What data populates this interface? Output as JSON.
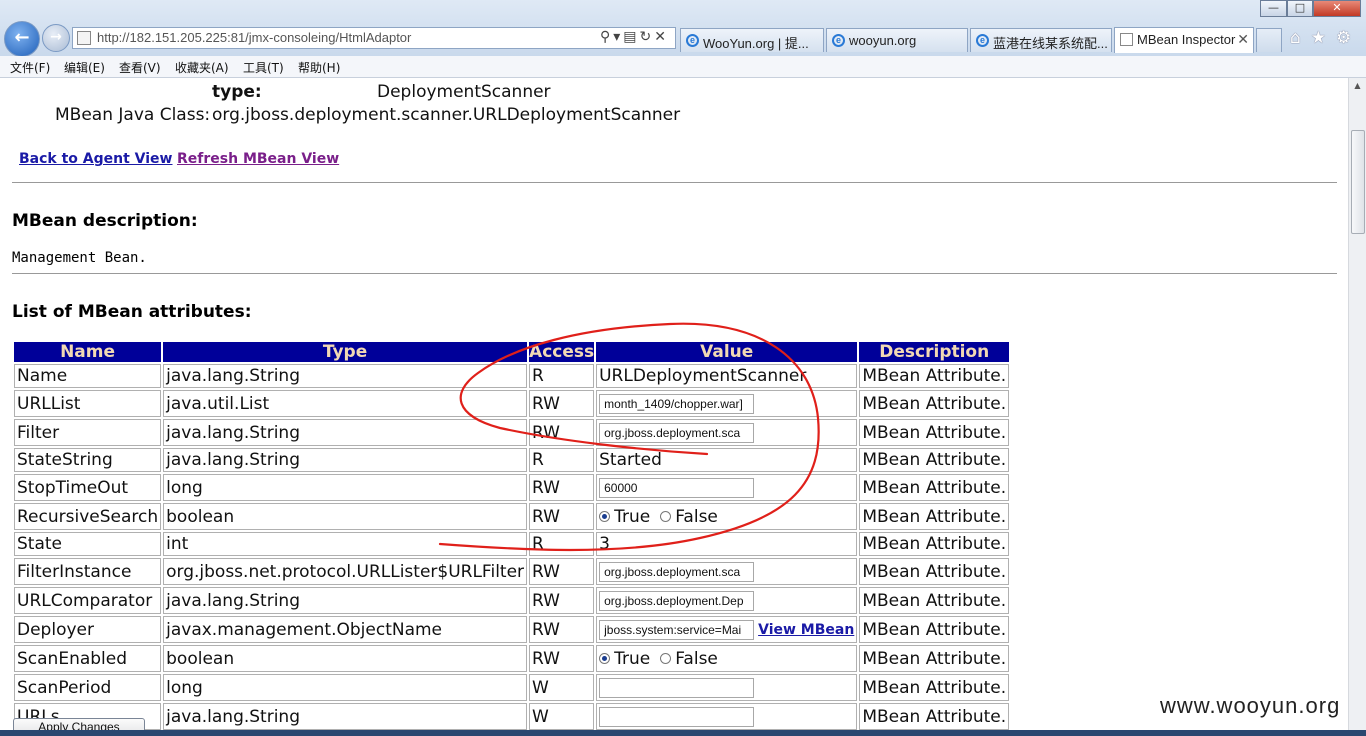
{
  "browser": {
    "url": "http://182.151.205.225:81/jmx-consoleing/HtmlAdaptor",
    "tabs": [
      {
        "label": "WooYun.org | 提...",
        "active": false
      },
      {
        "label": "wooyun.org",
        "active": false
      },
      {
        "label": "蓝港在线某系统配...",
        "active": false
      },
      {
        "label": "MBean Inspector",
        "active": true
      }
    ],
    "menu": [
      "文件(F)",
      "编辑(E)",
      "查看(V)",
      "收藏夹(A)",
      "工具(T)",
      "帮助(H)"
    ]
  },
  "mbean": {
    "type_label": "type:",
    "type_value": "DeploymentScanner",
    "class_label": "MBean Java Class:",
    "class_value": "org.jboss.deployment.scanner.URLDeploymentScanner"
  },
  "links": {
    "back": "Back to Agent View",
    "refresh": "Refresh MBean View"
  },
  "description": {
    "title": "MBean description:",
    "text": "Management Bean."
  },
  "attributes": {
    "title": "List of MBean attributes:",
    "columns": [
      "Name",
      "Type",
      "Access",
      "Value",
      "Description"
    ],
    "rows": [
      {
        "name": "Name",
        "type": "java.lang.String",
        "access": "R",
        "value": "URLDeploymentScanner",
        "kind": "text",
        "desc": "MBean Attribute."
      },
      {
        "name": "URLList",
        "type": "java.util.List",
        "access": "RW",
        "value": "month_1409/chopper.war]",
        "kind": "input",
        "desc": "MBean Attribute."
      },
      {
        "name": "Filter",
        "type": "java.lang.String",
        "access": "RW",
        "value": "org.jboss.deployment.sca",
        "kind": "input",
        "desc": "MBean Attribute."
      },
      {
        "name": "StateString",
        "type": "java.lang.String",
        "access": "R",
        "value": "Started",
        "kind": "text",
        "desc": "MBean Attribute."
      },
      {
        "name": "StopTimeOut",
        "type": "long",
        "access": "RW",
        "value": "60000",
        "kind": "input",
        "desc": "MBean Attribute."
      },
      {
        "name": "RecursiveSearch",
        "type": "boolean",
        "access": "RW",
        "value": "True",
        "kind": "radio",
        "desc": "MBean Attribute."
      },
      {
        "name": "State",
        "type": "int",
        "access": "R",
        "value": "3",
        "kind": "text",
        "desc": "MBean Attribute."
      },
      {
        "name": "FilterInstance",
        "type": "org.jboss.net.protocol.URLLister$URLFilter",
        "access": "RW",
        "value": "org.jboss.deployment.sca",
        "kind": "input",
        "desc": "MBean Attribute."
      },
      {
        "name": "URLComparator",
        "type": "java.lang.String",
        "access": "RW",
        "value": "org.jboss.deployment.Dep",
        "kind": "input",
        "desc": "MBean Attribute."
      },
      {
        "name": "Deployer",
        "type": "javax.management.ObjectName",
        "access": "RW",
        "value": "jboss.system:service=Mai",
        "kind": "input-link",
        "link": "View MBean",
        "desc": "MBean Attribute."
      },
      {
        "name": "ScanEnabled",
        "type": "boolean",
        "access": "RW",
        "value": "True",
        "kind": "radio",
        "desc": "MBean Attribute."
      },
      {
        "name": "ScanPeriod",
        "type": "long",
        "access": "W",
        "value": "",
        "kind": "input",
        "desc": "MBean Attribute."
      },
      {
        "name": "URLs",
        "type": "java.lang.String",
        "access": "W",
        "value": "",
        "kind": "input",
        "desc": "MBean Attribute."
      }
    ],
    "radio_true": "True",
    "radio_false": "False"
  },
  "apply_button": "Apply Changes",
  "watermark": "www.wooyun.org",
  "colors": {
    "table_header_bg": "#000099",
    "table_header_text": "#f2d9b4",
    "annotation": "#e0201a"
  }
}
